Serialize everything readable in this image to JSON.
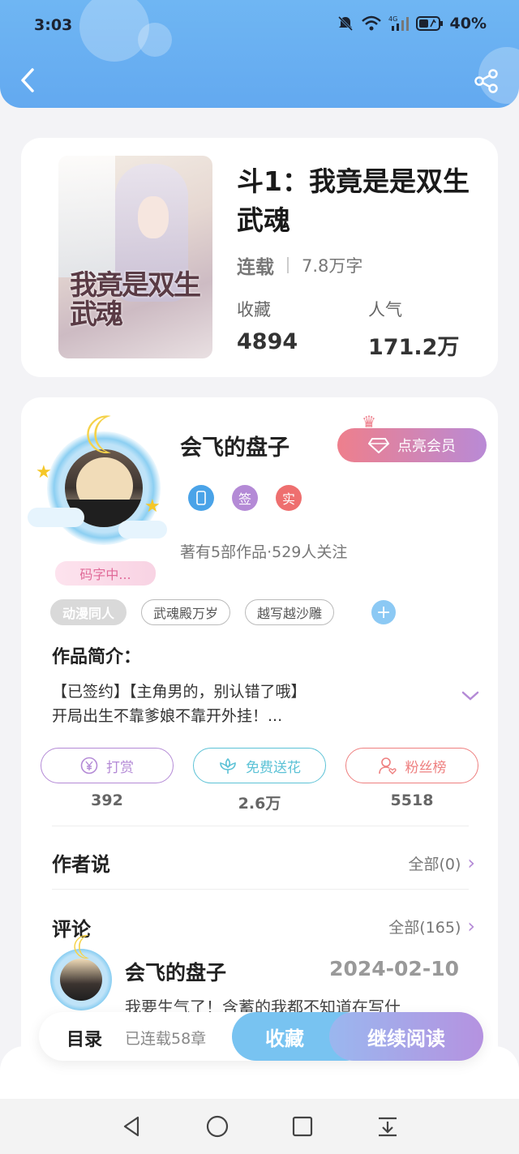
{
  "status_bar": {
    "time": "3:03",
    "battery": "40%",
    "network": "4G"
  },
  "book": {
    "cover_text": "我竟是双生武魂",
    "title": "斗1：我竟是是双生武魂",
    "status": "连载",
    "word_count": "7.8万字",
    "favorites_label": "收藏",
    "favorites_value": "4894",
    "popularity_label": "人气",
    "popularity_value": "171.2万"
  },
  "author": {
    "name": "会飞的盘子",
    "vip_button": "点亮会员",
    "typing_badge": "码字中...",
    "badges": [
      {
        "text": "",
        "color": "#4aa3e8"
      },
      {
        "text": "签",
        "color": "#b48ad6"
      },
      {
        "text": "实",
        "color": "#ee6f6f"
      }
    ],
    "stats": "著有5部作品·529人关注"
  },
  "tags": [
    "动漫同人",
    "武魂殿万岁",
    "越写越沙雕"
  ],
  "intro": {
    "title": "作品简介：",
    "line1": "【已签约】【主角男的，别认错了哦】",
    "line2": "开局出生不靠爹娘不靠开外挂！..."
  },
  "actions": [
    {
      "label": "打赏",
      "count": "392",
      "color": "#b48ad6",
      "icon": "yen-icon"
    },
    {
      "label": "免费送花",
      "count": "2.6万",
      "color": "#5cc2d6",
      "icon": "flower-icon"
    },
    {
      "label": "粉丝榜",
      "count": "5518",
      "color": "#ee7f7f",
      "icon": "fans-icon"
    }
  ],
  "author_says": {
    "title": "作者说",
    "link": "全部(0)"
  },
  "comments": {
    "title": "评论",
    "link": "全部(165)",
    "first": {
      "user": "会飞的盘子",
      "date": "2024-02-10",
      "text": "我要生气了！含蓄的我都不知道在写什"
    }
  },
  "bottom_bar": {
    "toc": "目录",
    "chapters": "已连载58章",
    "favorite": "收藏",
    "continue": "继续阅读"
  },
  "colors": {
    "header": "#6fb6f3",
    "accent_purple": "#b48ad6",
    "accent_blue": "#78c3f1"
  }
}
